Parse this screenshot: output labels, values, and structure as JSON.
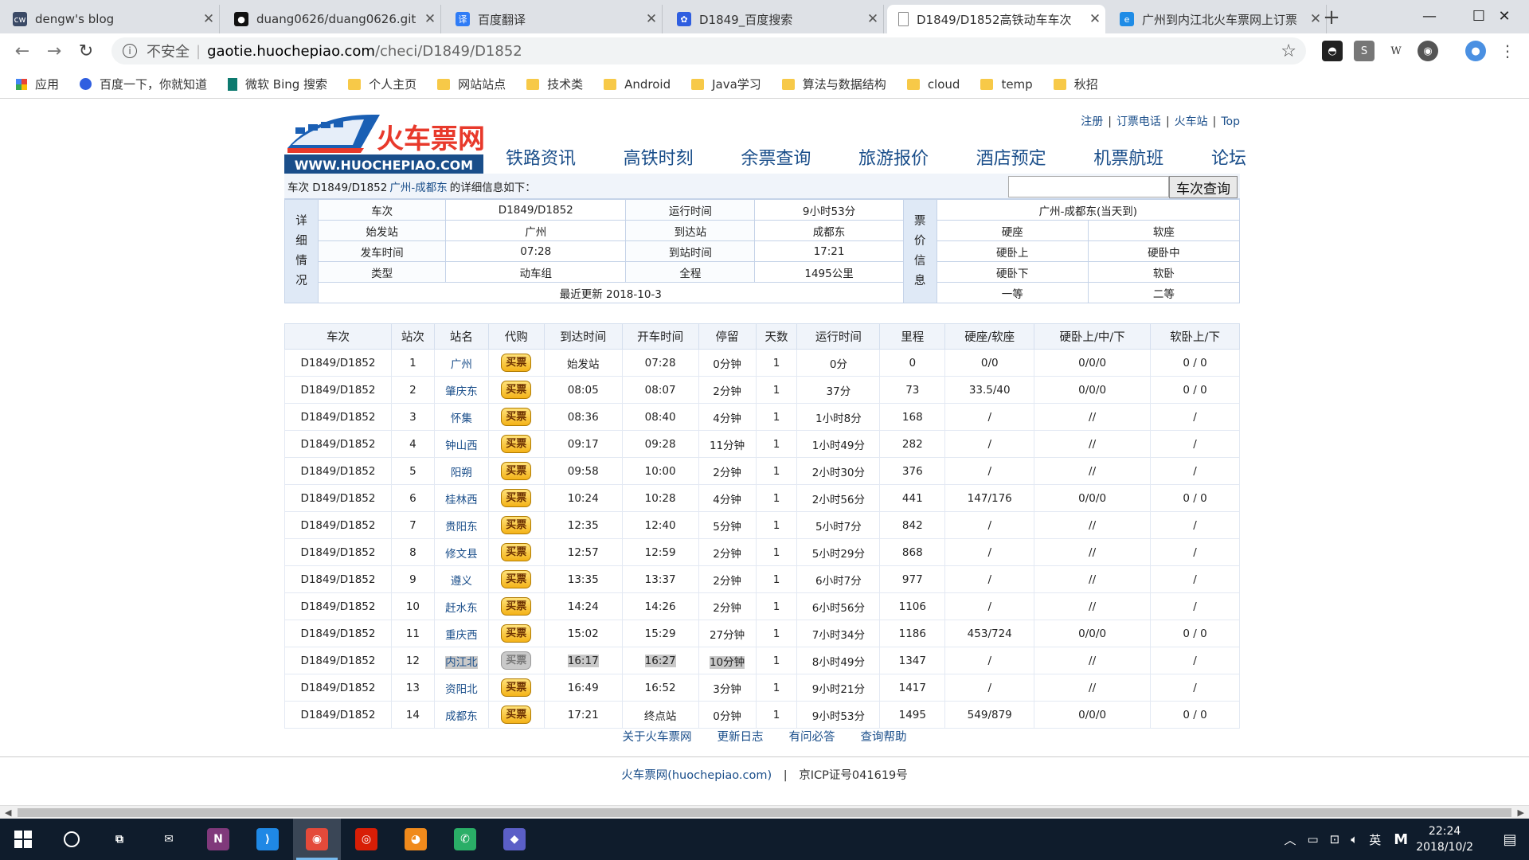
{
  "browser": {
    "tabs": [
      {
        "title": "dengw's blog",
        "icon": "blog-favicon",
        "color": "#3b4a66",
        "glyph": "cw"
      },
      {
        "title": "duang0626/duang0626.git",
        "icon": "github-icon",
        "color": "#111111",
        "glyph": "●"
      },
      {
        "title": "百度翻译",
        "icon": "baidu-translate-icon",
        "color": "#2f7cf6",
        "glyph": "译"
      },
      {
        "title": "D1849_百度搜索",
        "icon": "baidu-paw-icon",
        "color": "#2f5ee0",
        "glyph": "✿"
      },
      {
        "title": "D1849/D1852高铁动车车次",
        "icon": "page-icon",
        "color": "#ffffff",
        "glyph": ""
      },
      {
        "title": "广州到内江北火车票网上订票",
        "icon": "ie-icon",
        "color": "#1f8ce6",
        "glyph": "e"
      }
    ],
    "active_tab": 4,
    "new_tab": "+",
    "window_controls": {
      "minimize": "—",
      "maximize": "☐",
      "close": "✕"
    },
    "nav": {
      "back": "←",
      "forward": "→",
      "reload": "↻"
    },
    "address": {
      "security": "不安全",
      "domain": "gaotie.huochepiao.com",
      "path": "/checi/D1849/D1852"
    },
    "bookmarks": [
      "应用",
      "百度一下，你就知道",
      "微软 Bing 搜索",
      "个人主页",
      "网站站点",
      "技术类",
      "Android",
      "Java学习",
      "算法与数据结构",
      "cloud",
      "temp",
      "秋招"
    ]
  },
  "site": {
    "logo_text": "火车票网",
    "logo_url": "WWW.HUOCHEPIAO.COM",
    "top_links": [
      "注册",
      "订票电话",
      "火车站",
      "Top"
    ],
    "nav": [
      "铁路资讯",
      "高铁时刻",
      "余票查询",
      "旅游报价",
      "酒店预定",
      "机票航班",
      "论坛"
    ],
    "info_prefix": "车次 D1849/D1852",
    "info_route": "广州-成都东",
    "info_suffix": "的详细信息如下：",
    "search_button": "车次查询",
    "search_value": ""
  },
  "detail": {
    "left_header": [
      "详",
      "细",
      "情",
      "况"
    ],
    "right_header": [
      "票",
      "价",
      "信",
      "息"
    ],
    "rows": [
      [
        "车次",
        "D1849/D1852",
        "运行时间",
        "9小时53分"
      ],
      [
        "始发站",
        "广州",
        "到达站",
        "成都东"
      ],
      [
        "发车时间",
        "07:28",
        "到站时间",
        "17:21"
      ],
      [
        "类型",
        "动车组",
        "全程",
        "1495公里"
      ]
    ],
    "updated": "最近更新 2018-10-3",
    "price_title": "广州-成都东(当天到)",
    "price_rows": [
      [
        "硬座",
        "软座"
      ],
      [
        "硬卧上",
        "硬卧中"
      ],
      [
        "硬卧下",
        "软卧"
      ],
      [
        "一等",
        "二等"
      ]
    ]
  },
  "timetable": {
    "headers": [
      "车次",
      "站次",
      "站名",
      "代购",
      "到达时间",
      "开车时间",
      "停留",
      "天数",
      "运行时间",
      "里程",
      "硬座/软座",
      "硬卧上/中/下",
      "软卧上/下"
    ],
    "buy_label": "买票",
    "highlight_row": 11,
    "rows": [
      [
        "D1849/D1852",
        "1",
        "广州",
        "始发站",
        "07:28",
        "0分钟",
        "1",
        "0分",
        "0",
        "0/0",
        "0/0/0",
        "0 / 0"
      ],
      [
        "D1849/D1852",
        "2",
        "肇庆东",
        "08:05",
        "08:07",
        "2分钟",
        "1",
        "37分",
        "73",
        "33.5/40",
        "0/0/0",
        "0 / 0"
      ],
      [
        "D1849/D1852",
        "3",
        "怀集",
        "08:36",
        "08:40",
        "4分钟",
        "1",
        "1小时8分",
        "168",
        "/",
        "//",
        "/"
      ],
      [
        "D1849/D1852",
        "4",
        "钟山西",
        "09:17",
        "09:28",
        "11分钟",
        "1",
        "1小时49分",
        "282",
        "/",
        "//",
        "/"
      ],
      [
        "D1849/D1852",
        "5",
        "阳朔",
        "09:58",
        "10:00",
        "2分钟",
        "1",
        "2小时30分",
        "376",
        "/",
        "//",
        "/"
      ],
      [
        "D1849/D1852",
        "6",
        "桂林西",
        "10:24",
        "10:28",
        "4分钟",
        "1",
        "2小时56分",
        "441",
        "147/176",
        "0/0/0",
        "0 / 0"
      ],
      [
        "D1849/D1852",
        "7",
        "贵阳东",
        "12:35",
        "12:40",
        "5分钟",
        "1",
        "5小时7分",
        "842",
        "/",
        "//",
        "/"
      ],
      [
        "D1849/D1852",
        "8",
        "修文县",
        "12:57",
        "12:59",
        "2分钟",
        "1",
        "5小时29分",
        "868",
        "/",
        "//",
        "/"
      ],
      [
        "D1849/D1852",
        "9",
        "遵义",
        "13:35",
        "13:37",
        "2分钟",
        "1",
        "6小时7分",
        "977",
        "/",
        "//",
        "/"
      ],
      [
        "D1849/D1852",
        "10",
        "赶水东",
        "14:24",
        "14:26",
        "2分钟",
        "1",
        "6小时56分",
        "1106",
        "/",
        "//",
        "/"
      ],
      [
        "D1849/D1852",
        "11",
        "重庆西",
        "15:02",
        "15:29",
        "27分钟",
        "1",
        "7小时34分",
        "1186",
        "453/724",
        "0/0/0",
        "0 / 0"
      ],
      [
        "D1849/D1852",
        "12",
        "内江北",
        "16:17",
        "16:27",
        "10分钟",
        "1",
        "8小时49分",
        "1347",
        "/",
        "//",
        "/"
      ],
      [
        "D1849/D1852",
        "13",
        "资阳北",
        "16:49",
        "16:52",
        "3分钟",
        "1",
        "9小时21分",
        "1417",
        "/",
        "//",
        "/"
      ],
      [
        "D1849/D1852",
        "14",
        "成都东",
        "17:21",
        "终点站",
        "0分钟",
        "1",
        "9小时53分",
        "1495",
        "549/879",
        "0/0/0",
        "0 / 0"
      ]
    ]
  },
  "footer": {
    "links": [
      "关于火车票网",
      "更新日志",
      "有问必答",
      "查询帮助"
    ],
    "site_name": "火车票网(huochepiao.com)",
    "icp": "京ICP证号041619号",
    "separator": "|"
  },
  "taskbar": {
    "apps": [
      {
        "name": "task-view-icon",
        "glyph": "⧉",
        "color": "#0f1c2c"
      },
      {
        "name": "mail-icon",
        "glyph": "✉",
        "color": "#0f1c2c"
      },
      {
        "name": "onenote-icon",
        "glyph": "N",
        "color": "#80397b"
      },
      {
        "name": "vscode-icon",
        "glyph": "⟩",
        "color": "#1f88e5"
      },
      {
        "name": "chrome-icon",
        "glyph": "◉",
        "color": "#e44a3a"
      },
      {
        "name": "netease-music-icon",
        "glyph": "◎",
        "color": "#d81e06"
      },
      {
        "name": "ichat-icon",
        "glyph": "◕",
        "color": "#f08a1c"
      },
      {
        "name": "wechat-icon",
        "glyph": "✆",
        "color": "#2aae67"
      },
      {
        "name": "git-icon",
        "glyph": "◆",
        "color": "#5b5fc7"
      }
    ],
    "active_app": 4,
    "lang": "英",
    "ime": "M",
    "time": "22:24",
    "date": "2018/10/2"
  }
}
